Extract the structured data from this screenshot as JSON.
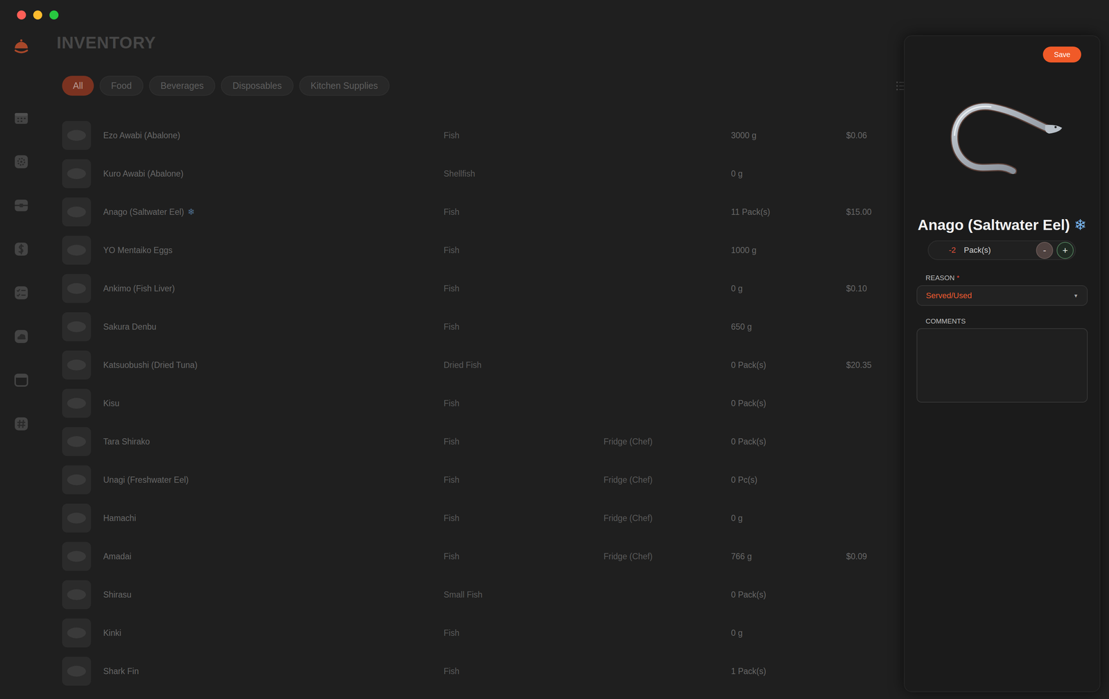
{
  "window": {
    "title": "INVENTORY"
  },
  "filters": [
    {
      "label": "All",
      "selected": true
    },
    {
      "label": "Food",
      "selected": false
    },
    {
      "label": "Beverages",
      "selected": false
    },
    {
      "label": "Disposables",
      "selected": false
    },
    {
      "label": "Kitchen Supplies",
      "selected": false
    }
  ],
  "table": {
    "rows": [
      {
        "name": "Ezo Awabi (Abalone)",
        "category": "Fish",
        "quantity": "3000 g",
        "price": "$0.06"
      },
      {
        "name": "Kuro Awabi (Abalone)",
        "category": "Shellfish",
        "quantity": "0 g"
      },
      {
        "name": "Anago (Saltwater Eel)",
        "badge": "❄",
        "category": "Fish",
        "quantity": "11 Pack(s)",
        "price": "$15.00"
      },
      {
        "name": "YO Mentaiko Eggs",
        "category": "Fish",
        "quantity": "1000 g"
      },
      {
        "name": "Ankimo (Fish Liver)",
        "category": "Fish",
        "quantity": "0 g",
        "price": "$0.10"
      },
      {
        "name": "Sakura Denbu",
        "category": "Fish",
        "quantity": "650 g"
      },
      {
        "name": "Katsuobushi (Dried Tuna)",
        "category": "Dried Fish",
        "quantity": "0 Pack(s)",
        "price": "$20.35"
      },
      {
        "name": "Kisu",
        "category": "Fish",
        "quantity": "0 Pack(s)"
      },
      {
        "name": "Tara Shirako",
        "category": "Fish",
        "location": "Fridge (Chef)",
        "quantity": "0 Pack(s)"
      },
      {
        "name": "Unagi (Freshwater Eel)",
        "category": "Fish",
        "location": "Fridge (Chef)",
        "quantity": "0 Pc(s)"
      },
      {
        "name": "Hamachi",
        "category": "Fish",
        "location": "Fridge (Chef)",
        "quantity": "0 g"
      },
      {
        "name": "Amadai",
        "category": "Fish",
        "location": "Fridge (Chef)",
        "quantity": "766 g",
        "price": "$0.09"
      },
      {
        "name": "Shirasu",
        "category": "Small Fish",
        "quantity": "0 Pack(s)"
      },
      {
        "name": "Kinki",
        "category": "Fish",
        "quantity": "0 g"
      },
      {
        "name": "Shark Fin",
        "category": "Fish",
        "quantity": "1 Pack(s)"
      }
    ]
  },
  "panel": {
    "save": "Save",
    "item": {
      "name": "Anago (Saltwater Eel)",
      "badge": "❄"
    },
    "quantity": {
      "value": "-2",
      "unit": "Pack(s)",
      "minus": "-",
      "plus": "+"
    },
    "reason": {
      "label": "REASON",
      "required": "*",
      "value": "Served/Used",
      "caret": "▼"
    },
    "comments": {
      "label": "COMMENTS",
      "value": ""
    }
  }
}
